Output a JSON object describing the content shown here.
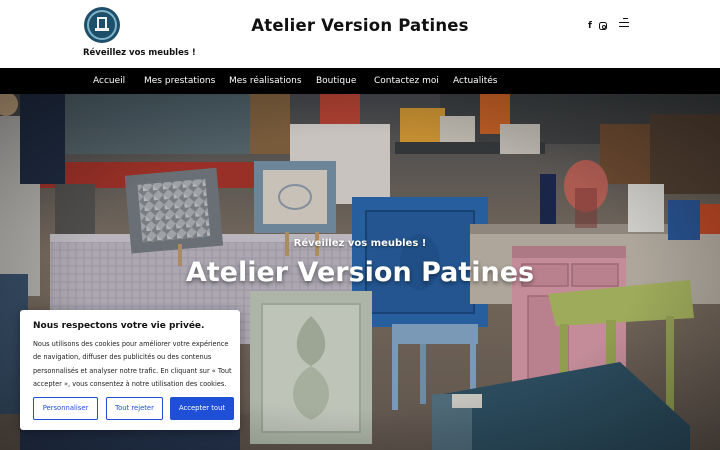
{
  "header": {
    "tagline": "Réveillez vos meubles !",
    "site_title": "Atelier Version Patines",
    "social": {
      "facebook_glyph": "f"
    },
    "icons": [
      "logo-chair-icon",
      "facebook-icon",
      "instagram-icon",
      "menu-icon"
    ]
  },
  "nav": {
    "items": [
      {
        "label": "Accueil"
      },
      {
        "label": "Mes prestations"
      },
      {
        "label": "Mes réalisations"
      },
      {
        "label": "Boutique"
      },
      {
        "label": "Contactez moi"
      },
      {
        "label": "Actualités"
      }
    ]
  },
  "hero": {
    "subtitle": "Réveillez vos meubles !",
    "title": "Atelier Version Patines"
  },
  "cookie": {
    "title": "Nous respectons votre vie privée.",
    "text": "Nous utilisons des cookies pour améliorer votre expérience de navigation, diffuser des publicités ou des contenus personnalisés et analyser notre trafic. En cliquant sur « Tout accepter », vous consentez à notre utilisation des cookies.",
    "customize_label": "Personnaliser",
    "reject_label": "Tout rejeter",
    "accept_label": "Accepter tout"
  },
  "colors": {
    "nav_bg": "#000000",
    "accent": "#1f4fd6",
    "text": "#111111"
  }
}
